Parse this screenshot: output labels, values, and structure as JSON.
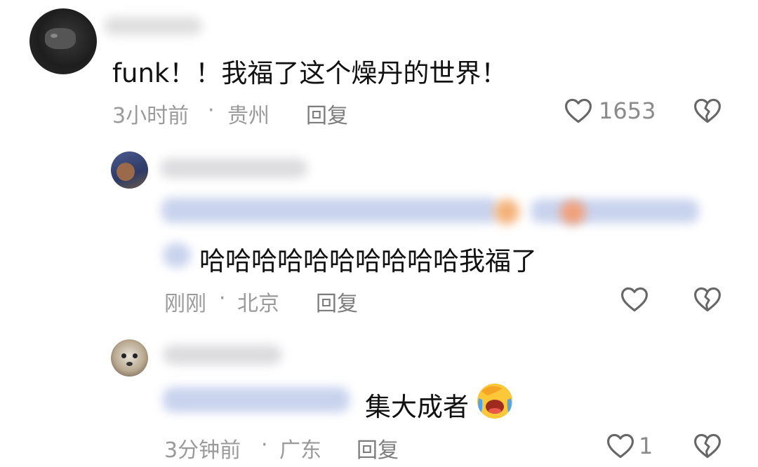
{
  "comments": [
    {
      "text": "funk！！我福了这个燥丹的世界！",
      "time": "3小时前",
      "sep": "·",
      "location": "贵州",
      "reply_label": "回复",
      "like_count": "1653",
      "like_icon": "heart-outline-icon",
      "dislike_icon": "broken-heart-icon"
    }
  ],
  "replies": [
    {
      "text": "哈哈哈哈哈哈哈哈哈哈我福了",
      "time": "刚刚",
      "sep": "·",
      "location": "北京",
      "reply_label": "回复",
      "like_count": "",
      "like_icon": "heart-outline-icon",
      "dislike_icon": "broken-heart-icon"
    },
    {
      "text": "集大成者",
      "emoji": "facepalm-laugh-emoji",
      "time": "3分钟前",
      "sep": "·",
      "location": "广东",
      "reply_label": "回复",
      "like_count": "1",
      "like_icon": "heart-outline-icon",
      "dislike_icon": "broken-heart-icon"
    }
  ],
  "colors": {
    "text": "#111111",
    "meta": "#9a9a9a",
    "icon": "#666666",
    "blur": "#c9d3ee"
  }
}
